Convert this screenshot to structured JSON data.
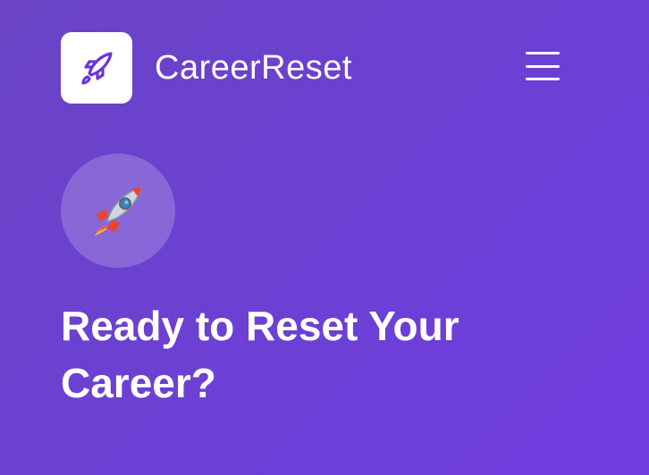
{
  "header": {
    "brand_name": "CareerReset",
    "logo_icon": "rocket-outline-icon",
    "menu_icon": "hamburger-menu-icon"
  },
  "hero": {
    "icon": "rocket-emoji-icon",
    "headline": "Ready to Reset Your Career?"
  },
  "colors": {
    "background_start": "#6a44c4",
    "background_end": "#703ce0",
    "logo_accent": "#6a35d9",
    "text": "#ffffff"
  }
}
